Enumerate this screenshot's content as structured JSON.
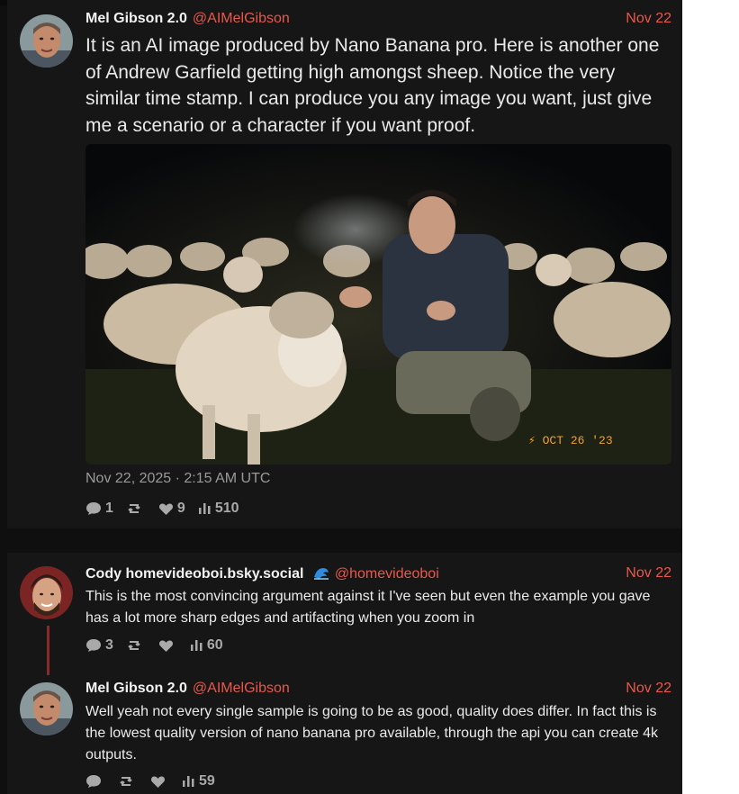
{
  "colors": {
    "accent": "#e8584c",
    "background": "#161616",
    "text": "#eaeaea",
    "muted": "#9a9a9a"
  },
  "main_post": {
    "author_name": "Mel Gibson 2.0",
    "handle": "@AIMelGibson",
    "date": "Nov 22",
    "text": "It is an AI image produced by Nano Banana pro. Here is another one of Andrew Garfield getting high amongst sheep. Notice the very similar time stamp. I can produce you any image you want, just give me a scenario or a character if you want proof.",
    "image_timestamp": "⚡ OCT 26 '23",
    "posted_at": "Nov 22, 2025 · 2:15 AM UTC",
    "stats": {
      "replies": "1",
      "retweets": "",
      "likes": "9",
      "views": "510"
    }
  },
  "reply_1": {
    "author_name": "Cody homevideoboi.bsky.social",
    "handle": "@homevideoboi",
    "date": "Nov 22",
    "text": "This is the most convincing argument against it I've seen but even the example you gave has a lot more sharp edges and artifacting when you zoom in",
    "stats": {
      "replies": "3",
      "retweets": "",
      "likes": "",
      "views": "60"
    }
  },
  "reply_2": {
    "author_name": "Mel Gibson 2.0",
    "handle": "@AIMelGibson",
    "date": "Nov 22",
    "text": "Well yeah not every single sample is going to be as good, quality does differ. In fact this is the lowest quality version of nano banana pro available, through the api you can create 4k outputs.",
    "stats": {
      "replies": "",
      "retweets": "",
      "likes": "",
      "views": "59"
    }
  },
  "icons": [
    "comment-icon",
    "retweet-icon",
    "heart-icon",
    "views-icon",
    "wave-emoji-icon"
  ]
}
